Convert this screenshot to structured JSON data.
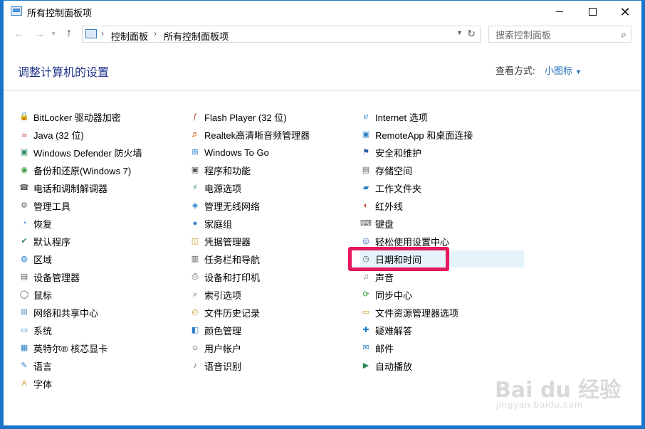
{
  "window": {
    "title": "所有控制面板项"
  },
  "address": {
    "segments": [
      "控制面板",
      "所有控制面板项"
    ]
  },
  "search": {
    "placeholder": "搜索控制面板"
  },
  "header": {
    "title": "调整计算机的设置",
    "view_label": "查看方式:",
    "view_value": "小图标"
  },
  "columns": [
    [
      {
        "label": "BitLocker 驱动器加密",
        "icon": "bitlocker-icon"
      },
      {
        "label": "Java (32 位)",
        "icon": "java-icon"
      },
      {
        "label": "Windows Defender 防火墙",
        "icon": "firewall-icon"
      },
      {
        "label": "备份和还原(Windows 7)",
        "icon": "backup-icon"
      },
      {
        "label": "电话和调制解调器",
        "icon": "phone-modem-icon"
      },
      {
        "label": "管理工具",
        "icon": "admin-tools-icon"
      },
      {
        "label": "恢复",
        "icon": "recovery-icon"
      },
      {
        "label": "默认程序",
        "icon": "default-programs-icon"
      },
      {
        "label": "区域",
        "icon": "region-icon"
      },
      {
        "label": "设备管理器",
        "icon": "device-manager-icon"
      },
      {
        "label": "鼠标",
        "icon": "mouse-icon"
      },
      {
        "label": "网络和共享中心",
        "icon": "network-icon"
      },
      {
        "label": "系统",
        "icon": "system-icon"
      },
      {
        "label": "英特尔® 核芯显卡",
        "icon": "intel-graphics-icon"
      },
      {
        "label": "语言",
        "icon": "language-icon"
      },
      {
        "label": "字体",
        "icon": "fonts-icon"
      }
    ],
    [
      {
        "label": "Flash Player (32 位)",
        "icon": "flash-icon"
      },
      {
        "label": "Realtek高清晰音频管理器",
        "icon": "realtek-audio-icon"
      },
      {
        "label": "Windows To Go",
        "icon": "windows-to-go-icon"
      },
      {
        "label": "程序和功能",
        "icon": "programs-icon"
      },
      {
        "label": "电源选项",
        "icon": "power-icon"
      },
      {
        "label": "管理无线网络",
        "icon": "wireless-icon"
      },
      {
        "label": "家庭组",
        "icon": "homegroup-icon"
      },
      {
        "label": "凭据管理器",
        "icon": "credential-icon"
      },
      {
        "label": "任务栏和导航",
        "icon": "taskbar-icon"
      },
      {
        "label": "设备和打印机",
        "icon": "printer-icon"
      },
      {
        "label": "索引选项",
        "icon": "indexing-icon"
      },
      {
        "label": "文件历史记录",
        "icon": "file-history-icon"
      },
      {
        "label": "颜色管理",
        "icon": "color-management-icon"
      },
      {
        "label": "用户帐户",
        "icon": "user-accounts-icon"
      },
      {
        "label": "语音识别",
        "icon": "speech-icon"
      }
    ],
    [
      {
        "label": "Internet 选项",
        "icon": "internet-options-icon"
      },
      {
        "label": "RemoteApp 和桌面连接",
        "icon": "remoteapp-icon"
      },
      {
        "label": "安全和维护",
        "icon": "security-flag-icon"
      },
      {
        "label": "存储空间",
        "icon": "storage-icon"
      },
      {
        "label": "工作文件夹",
        "icon": "work-folders-icon"
      },
      {
        "label": "红外线",
        "icon": "infrared-icon"
      },
      {
        "label": "键盘",
        "icon": "keyboard-icon"
      },
      {
        "label": "轻松使用设置中心",
        "icon": "ease-of-access-icon"
      },
      {
        "label": "日期和时间",
        "icon": "date-time-icon"
      },
      {
        "label": "声音",
        "icon": "sound-icon"
      },
      {
        "label": "同步中心",
        "icon": "sync-icon"
      },
      {
        "label": "文件资源管理器选项",
        "icon": "explorer-options-icon"
      },
      {
        "label": "疑难解答",
        "icon": "troubleshoot-icon"
      },
      {
        "label": "邮件",
        "icon": "mail-icon"
      },
      {
        "label": "自动播放",
        "icon": "autoplay-icon"
      }
    ]
  ],
  "selected_item": "日期和时间",
  "watermark": {
    "main": "Bai du 经验",
    "sub": "jingyan.baidu.com"
  },
  "colors": {
    "accent": "#1e6bb8",
    "title": "#1e3287",
    "highlight": "#e5185e",
    "selected_bg": "#e5f3fb"
  }
}
